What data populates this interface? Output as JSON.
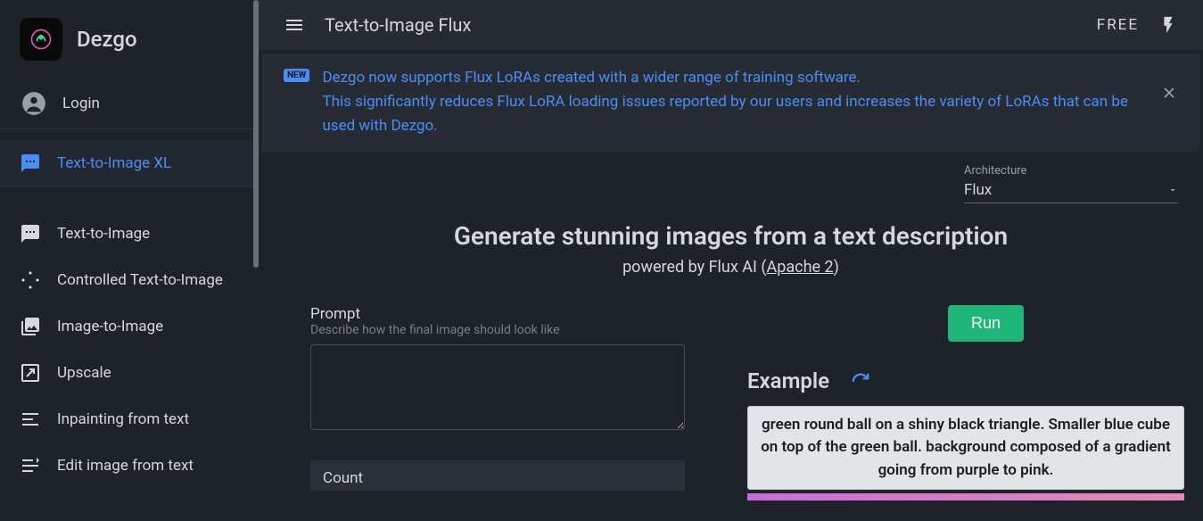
{
  "app": {
    "name": "Dezgo"
  },
  "login": {
    "label": "Login"
  },
  "sidebar": {
    "items": [
      {
        "label": "Text-to-Image XL",
        "active": true,
        "icon": "sms"
      },
      {
        "label": "Text-to-Image",
        "active": false,
        "icon": "sms"
      },
      {
        "label": "Controlled Text-to-Image",
        "active": false,
        "icon": "control"
      },
      {
        "label": "Image-to-Image",
        "active": false,
        "icon": "image"
      },
      {
        "label": "Upscale",
        "active": false,
        "icon": "upscale"
      },
      {
        "label": "Inpainting from text",
        "active": false,
        "icon": "inpaint"
      },
      {
        "label": "Edit image from text",
        "active": false,
        "icon": "edit"
      }
    ]
  },
  "topbar": {
    "title": "Text-to-Image Flux",
    "free": "FREE"
  },
  "banner": {
    "badge": "NEW",
    "line1": "Dezgo now supports Flux LoRAs created with a wider range of training software.",
    "line2": "This significantly reduces Flux LoRA loading issues reported by our users and increases the variety of LoRAs that can be used with Dezgo."
  },
  "architecture": {
    "label": "Architecture",
    "value": "Flux"
  },
  "hero": {
    "title": "Generate stunning images from a text description",
    "sub_prefix": "powered by Flux AI (",
    "sub_link": "Apache 2",
    "sub_suffix": ")"
  },
  "prompt": {
    "label": "Prompt",
    "hint": "Describe how the final image should look like",
    "value": ""
  },
  "count": {
    "label": "Count"
  },
  "run": {
    "label": "Run"
  },
  "example": {
    "title": "Example",
    "text": "green round ball on a shiny black triangle. Smaller blue cube on top of the green ball. background composed of a gradient going from purple to pink."
  }
}
